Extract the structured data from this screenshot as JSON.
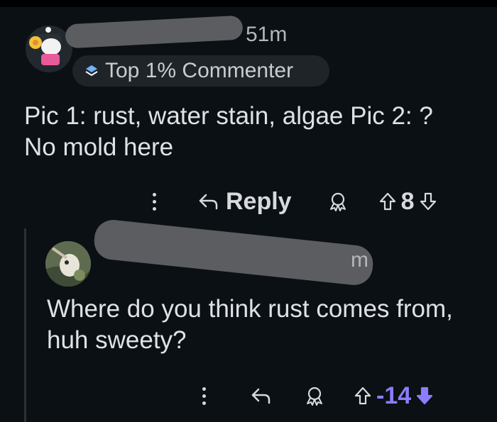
{
  "comment1": {
    "time": "51m",
    "badge": "Top 1% Commenter",
    "body": "Pic 1: rust, water stain, algae Pic 2: ? No mold here",
    "reply_label": "Reply",
    "score": "8"
  },
  "comment2": {
    "time": "m",
    "body": "Where do you think rust comes from, huh sweety?",
    "score": "-14"
  },
  "colors": {
    "background": "#0b1014",
    "text": "#dfe2e4",
    "downvote_active": "#8a7dff",
    "badge_bg": "#1f2429"
  },
  "icons": [
    "overflow-menu-icon",
    "reply-arrow-icon",
    "award-icon",
    "upvote-arrow-icon",
    "downvote-arrow-icon",
    "top-commenter-badge-icon"
  ]
}
